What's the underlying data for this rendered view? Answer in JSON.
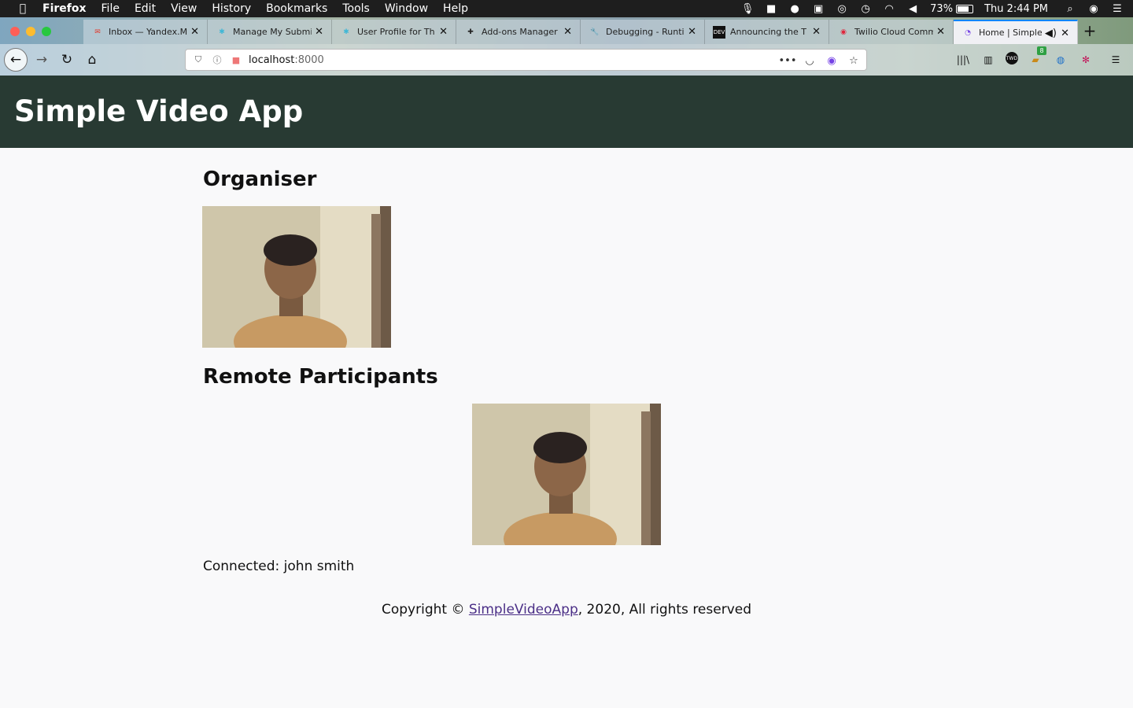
{
  "menubar": {
    "app": "Firefox",
    "items": [
      "File",
      "Edit",
      "View",
      "History",
      "Bookmarks",
      "Tools",
      "Window",
      "Help"
    ],
    "battery": "73%",
    "clock": "Thu 2:44 PM"
  },
  "tabs": [
    {
      "title": "Inbox — Yandex.Mail",
      "icon": "mail-icon"
    },
    {
      "title": "Manage My Submissions",
      "icon": "puzzle-icon"
    },
    {
      "title": "User Profile for Th",
      "icon": "puzzle-icon"
    },
    {
      "title": "Add-ons Manager",
      "icon": "extension-icon"
    },
    {
      "title": "Debugging - Runtime",
      "icon": "wrench-icon"
    },
    {
      "title": "Announcing the T",
      "icon": "dev-icon"
    },
    {
      "title": "Twilio Cloud Comm",
      "icon": "twilio-icon"
    },
    {
      "title": "Home | Simple",
      "icon": "globe-icon"
    }
  ],
  "urlbar": {
    "host": "localhost",
    "rest": ":8000"
  },
  "toolbar": {
    "badge": "8",
    "avatar_label": "TWD"
  },
  "site": {
    "title": "Simple Video App",
    "organiser_heading": "Organiser",
    "remote_heading": "Remote Participants",
    "connected": "Connected: john smith",
    "footer_prefix": "Copyright © ",
    "footer_link": "SimpleVideoApp",
    "footer_suffix": ", 2020, All rights reserved"
  },
  "colors": {
    "header_bg": "#283a33",
    "link": "#4b2f87",
    "active_tab_accent": "#0a84ff"
  }
}
